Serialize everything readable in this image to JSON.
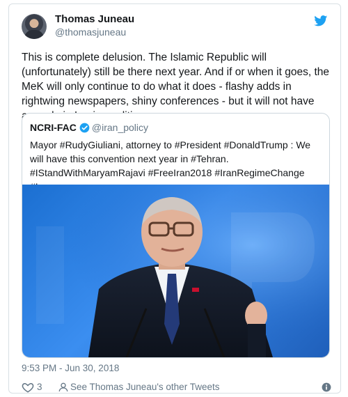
{
  "author": {
    "name": "Thomas Juneau",
    "handle": "@thomasjuneau"
  },
  "tweet": {
    "text": "This is complete delusion. The Islamic Republic will (unfortunately) still be there next year. And if or when it goes, the MeK will only continue to do what it does - flashy adds in rightwing newspapers, shiny conferences - but it will not have any role in Iranian politics."
  },
  "quoted": {
    "name": "NCRI-FAC",
    "handle": "@iran_policy",
    "text": "Mayor #RudyGiuliani, attorney to #President #DonaldTrump : We will have this convention next year in #Tehran. #IStandWithMaryamRajavi #FreeIran2018 #IranRegimeChange #Iran"
  },
  "footer": {
    "timestamp": "9:53 PM - Jun 30, 2018",
    "like_count": "3",
    "other_tweets_label": "See Thomas Juneau's other Tweets"
  },
  "colors": {
    "twitter_blue": "#1da1f2",
    "secondary_text": "#657786",
    "border": "#ccd6dd"
  },
  "icons": [
    "twitter-bird-icon",
    "verified-badge-icon",
    "heart-icon",
    "person-icon",
    "info-icon"
  ]
}
